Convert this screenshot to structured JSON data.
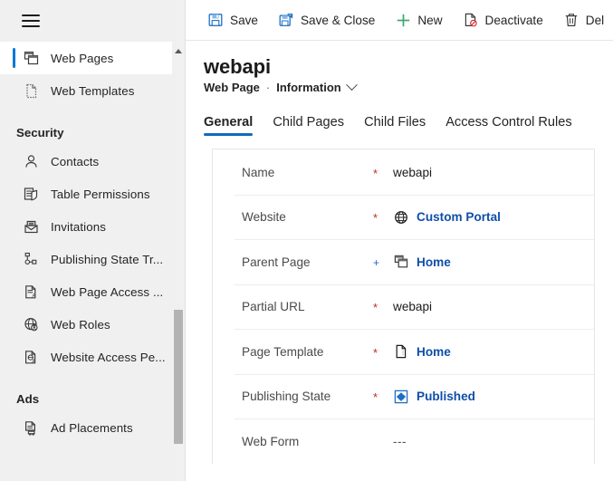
{
  "sidebar": {
    "menu_icon": "hamburger-icon",
    "items": [
      {
        "label": "Web Pages",
        "icon": "web-pages-icon",
        "selected": true
      },
      {
        "label": "Web Templates",
        "icon": "web-template-icon",
        "selected": false
      }
    ],
    "groups": [
      {
        "title": "Security",
        "items": [
          {
            "label": "Contacts",
            "icon": "contact-icon"
          },
          {
            "label": "Table  Permissions",
            "icon": "table-permissions-icon"
          },
          {
            "label": "Invitations",
            "icon": "invitation-icon"
          },
          {
            "label": "Publishing State Tr...",
            "icon": "publishing-state-transition-icon"
          },
          {
            "label": "Web Page Access ...",
            "icon": "web-page-access-icon"
          },
          {
            "label": "Web Roles",
            "icon": "web-roles-icon"
          },
          {
            "label": "Website Access Pe...",
            "icon": "website-access-icon"
          }
        ]
      },
      {
        "title": "Ads",
        "items": [
          {
            "label": "Ad Placements",
            "icon": "ad-placements-icon"
          }
        ]
      }
    ]
  },
  "command_bar": {
    "buttons": [
      {
        "label": "Save",
        "icon": "save-icon"
      },
      {
        "label": "Save & Close",
        "icon": "save-and-close-icon"
      },
      {
        "label": "New",
        "icon": "add-icon"
      },
      {
        "label": "Deactivate",
        "icon": "deactivate-icon"
      },
      {
        "label": "Del",
        "icon": "delete-icon"
      }
    ]
  },
  "record": {
    "title": "webapi",
    "entity": "Web Page",
    "separator": "·",
    "form_name": "Information",
    "form_chevron": "chevron-down-icon"
  },
  "tabs": [
    {
      "label": "General",
      "active": true
    },
    {
      "label": "Child Pages",
      "active": false
    },
    {
      "label": "Child Files",
      "active": false
    },
    {
      "label": "Access Control Rules",
      "active": false
    }
  ],
  "form": {
    "rows": [
      {
        "label": "Name",
        "required": "*",
        "required_type": "required",
        "value": "webapi",
        "is_link": false,
        "icon": ""
      },
      {
        "label": "Website",
        "required": "*",
        "required_type": "required",
        "value": "Custom Portal",
        "is_link": true,
        "icon": "globe-icon"
      },
      {
        "label": "Parent Page",
        "required": "+",
        "required_type": "recommended",
        "value": "Home",
        "is_link": true,
        "icon": "web-pages-icon"
      },
      {
        "label": "Partial URL",
        "required": "*",
        "required_type": "required",
        "value": "webapi",
        "is_link": false,
        "icon": ""
      },
      {
        "label": "Page Template",
        "required": "*",
        "required_type": "required",
        "value": "Home",
        "is_link": true,
        "icon": "page-template-icon"
      },
      {
        "label": "Publishing State",
        "required": "*",
        "required_type": "required",
        "value": "Published",
        "is_link": true,
        "icon": "publishing-state-icon"
      },
      {
        "label": "Web Form",
        "required": "",
        "required_type": "none",
        "value": "---",
        "is_link": false,
        "icon": ""
      }
    ]
  },
  "colors": {
    "accent": "#0f6cbd",
    "selected_indicator": "#0078d4",
    "link": "#0f4fa8",
    "required": "#c42b1c",
    "recommended": "#2b5fd9",
    "sidebar_bg": "#f0f0f0",
    "new_icon": "#3aa76d"
  }
}
